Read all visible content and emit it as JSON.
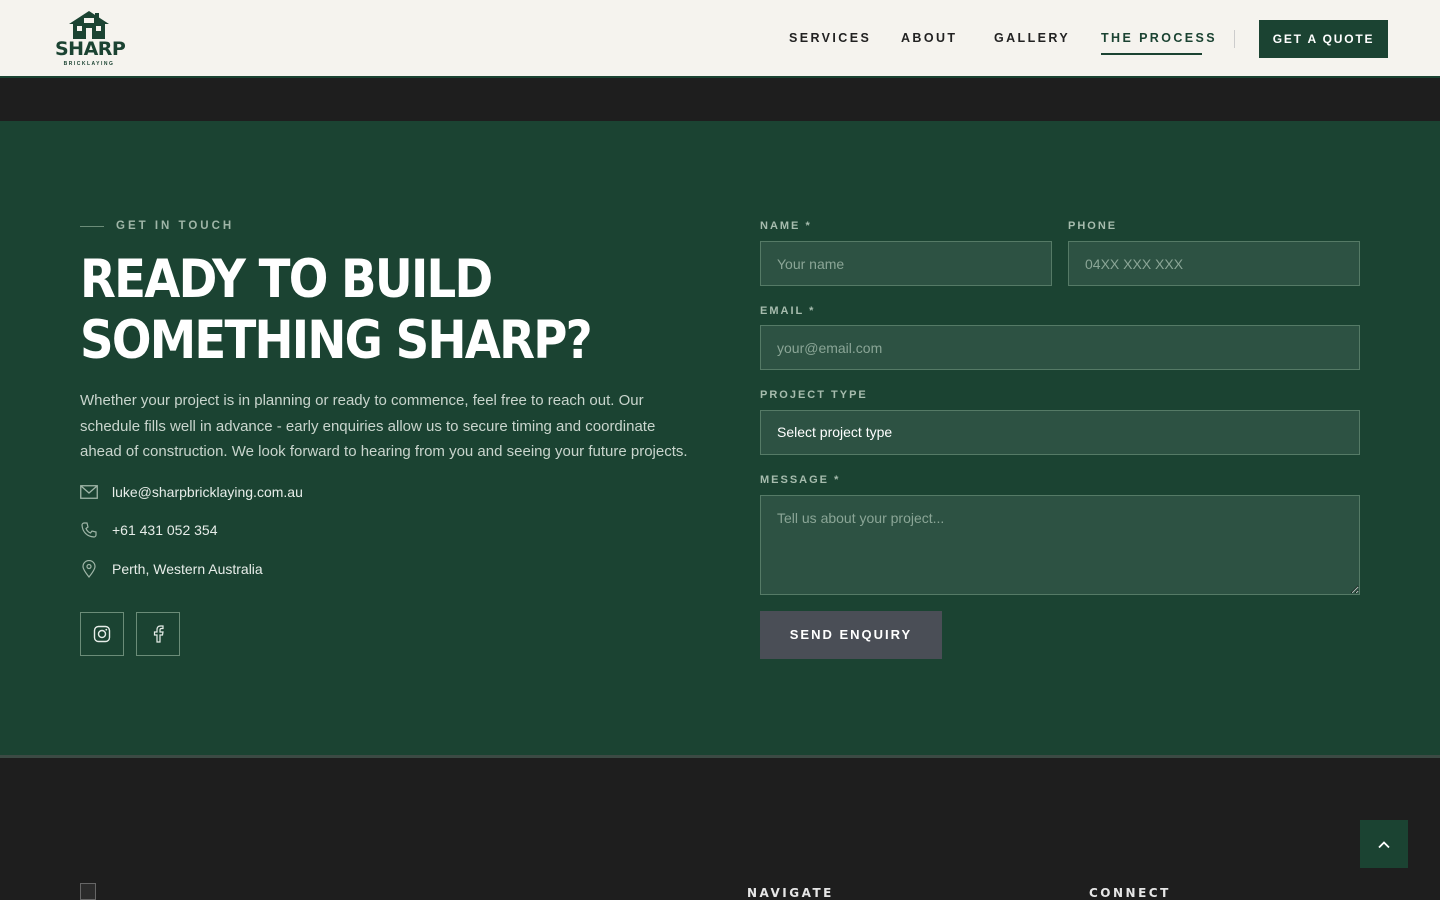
{
  "header": {
    "logo_text": "SHARP",
    "logo_sub": "BRICKLAYING",
    "nav": [
      {
        "label": "SERVICES"
      },
      {
        "label": "ABOUT"
      },
      {
        "label": "GALLERY"
      },
      {
        "label": "THE PROCESS",
        "active": true
      }
    ],
    "cta_label": "GET A QUOTE"
  },
  "contact": {
    "eyebrow": "GET IN TOUCH",
    "headline_line1": "READY TO BUILD",
    "headline_line2": "SOMETHING SHARP?",
    "lead": "Whether your project is in planning or ready to commence, feel free to reach out. Our schedule fills well in advance - early enquiries allow us to secure timing and coordinate ahead of construction. We look forward to hearing from you and seeing your future projects.",
    "email": "luke@sharpbricklaying.com.au",
    "phone": "+61 431 052 354",
    "location": "Perth, Western Australia",
    "social": [
      {
        "icon": "instagram-icon"
      },
      {
        "icon": "facebook-icon"
      }
    ]
  },
  "form": {
    "name_label": "NAME *",
    "name_placeholder": "Your name",
    "phone_label": "PHONE",
    "phone_placeholder": "04XX XXX XXX",
    "email_label": "EMAIL *",
    "email_placeholder": "your@email.com",
    "project_label": "PROJECT TYPE",
    "project_selected": "Select project type",
    "message_label": "MESSAGE *",
    "message_placeholder": "Tell us about your project...",
    "submit_label": "SEND ENQUIRY"
  },
  "footer": {
    "navigate_heading": "NAVIGATE",
    "connect_heading": "CONNECT"
  },
  "colors": {
    "brand_green": "#1b4332",
    "header_bg": "#f5f3ee",
    "dark_bg": "#1e1e1e",
    "button_grey": "#4a4e56"
  }
}
